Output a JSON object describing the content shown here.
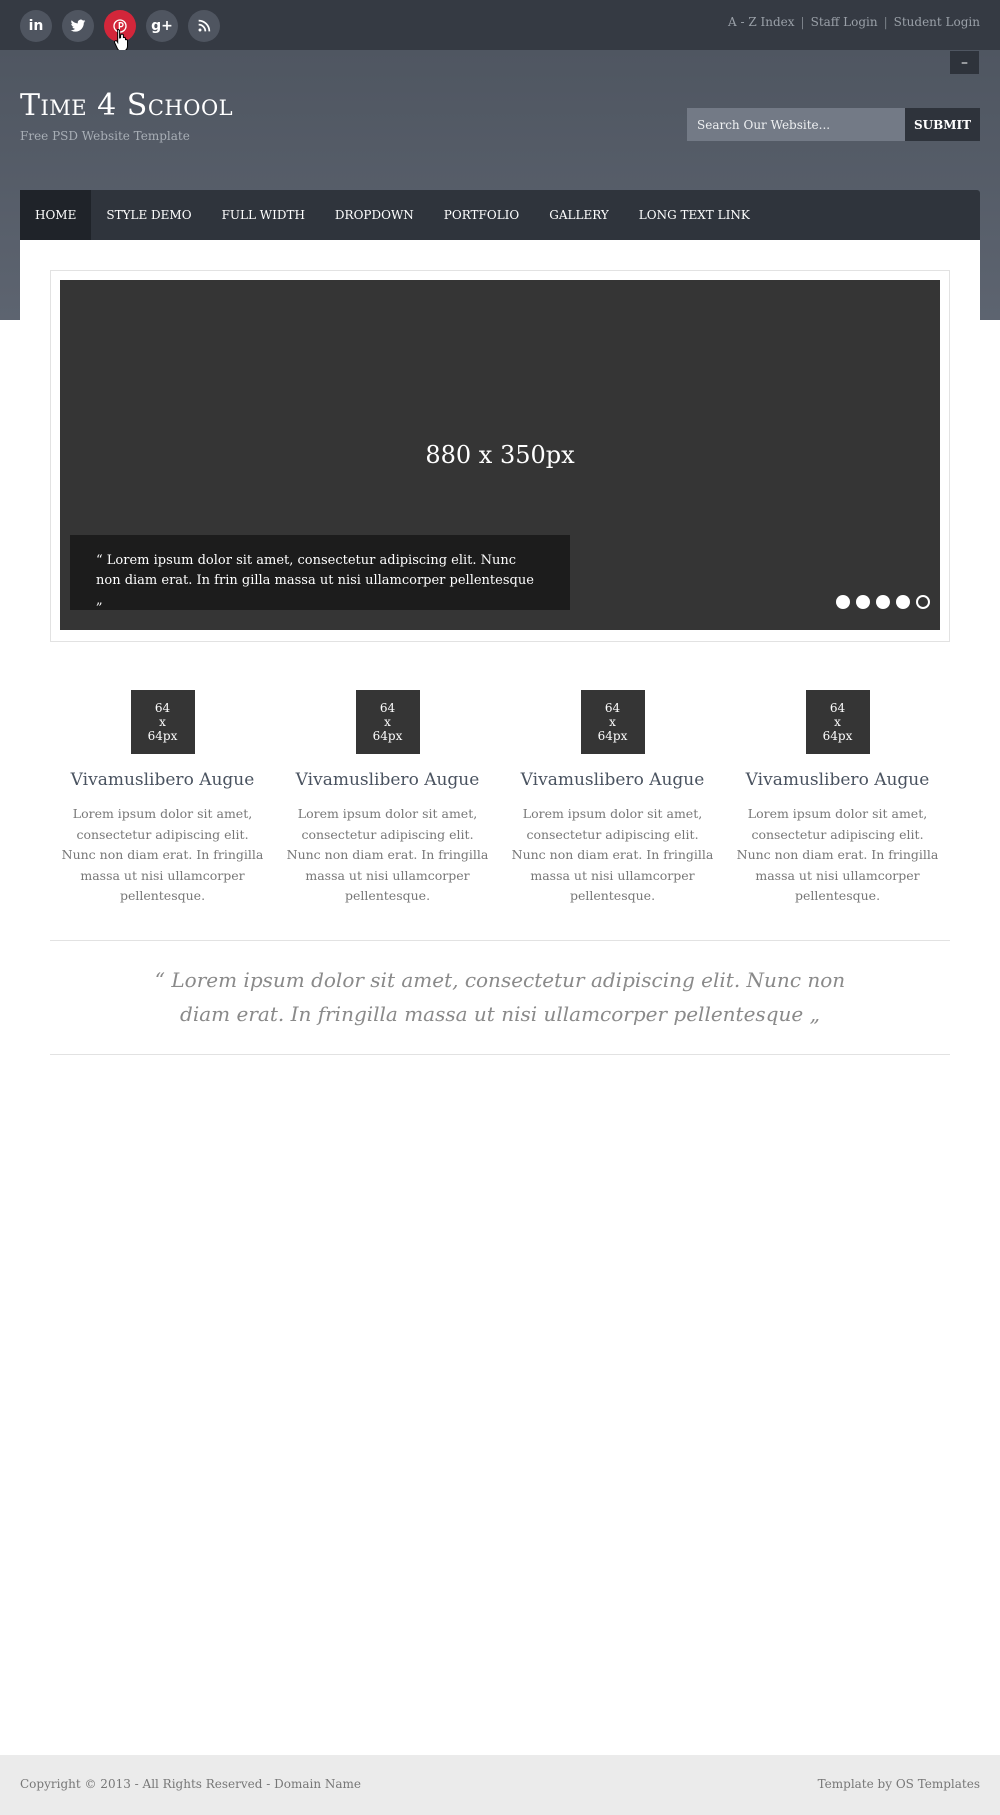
{
  "topbar": {
    "social": [
      {
        "icon": "linkedin-icon",
        "glyph": "in"
      },
      {
        "icon": "twitter-icon",
        "glyph": ""
      },
      {
        "icon": "pinterest-icon",
        "glyph": ""
      },
      {
        "icon": "google-plus-icon",
        "glyph": "g+"
      },
      {
        "icon": "rss-icon",
        "glyph": ""
      }
    ],
    "links": [
      "A - Z Index",
      "Staff Login",
      "Student Login"
    ],
    "separator": "|"
  },
  "header": {
    "minus_label": "–",
    "logo": "Time 4 School",
    "tagline": "Free PSD Website Template",
    "search_placeholder": "Search Our Website...",
    "submit_label": "SUBMIT"
  },
  "nav": {
    "items": [
      "HOME",
      "STYLE DEMO",
      "FULL WIDTH",
      "DROPDOWN",
      "PORTFOLIO",
      "GALLERY",
      "LONG TEXT LINK"
    ]
  },
  "slider": {
    "placeholder": "880 x 350px",
    "caption": "“ Lorem ipsum dolor sit amet, consectetur adipiscing elit. Nunc non diam erat. In frin gilla massa ut nisi ullamcorper pellentesque „",
    "dot_count": 5,
    "current_dot": 5
  },
  "features": [
    {
      "thumb": "64\nx\n64px",
      "title": "Vivamuslibero Augue",
      "text": "Lorem ipsum dolor sit amet, consectetur adipiscing elit. Nunc non diam erat. In fringilla massa ut nisi ullamcorper pellentesque."
    },
    {
      "thumb": "64\nx\n64px",
      "title": "Vivamuslibero Augue",
      "text": "Lorem ipsum dolor sit amet, consectetur adipiscing elit. Nunc non diam erat. In fringilla massa ut nisi ullamcorper pellentesque."
    },
    {
      "thumb": "64\nx\n64px",
      "title": "Vivamuslibero Augue",
      "text": "Lorem ipsum dolor sit amet, consectetur adipiscing elit. Nunc non diam erat. In fringilla massa ut nisi ullamcorper pellentesque."
    },
    {
      "thumb": "64\nx\n64px",
      "title": "Vivamuslibero Augue",
      "text": "Lorem ipsum dolor sit amet, consectetur adipiscing elit. Nunc non diam erat. In fringilla massa ut nisi ullamcorper pellentesque."
    }
  ],
  "quote": "“ Lorem ipsum dolor sit amet, consectetur adipiscing elit. Nunc non diam erat. In fringilla massa ut nisi ullamcorper pellentesque „",
  "footer": {
    "copyright": "Copyright © 2013 - All Rights Reserved - Domain Name",
    "credit": "Template by OS Templates"
  },
  "colors": {
    "topbar": "#353a43",
    "header": "#555c67",
    "accent_pinterest": "#d3263a",
    "nav": "#2f343c",
    "placeholder_dark": "#353535"
  }
}
